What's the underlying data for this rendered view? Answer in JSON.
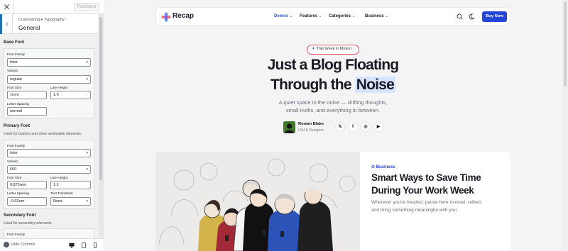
{
  "customizer": {
    "publish_label": "Published",
    "breadcrumb": "Customizing ▸ Typography",
    "section_title": "General",
    "base_font": {
      "heading": "Base Font",
      "family_label": "Font Family",
      "family_value": "Inter",
      "variant_label": "Variant",
      "variant_value": "regular",
      "size_label": "Font Size",
      "size_value": "1rem",
      "line_height_label": "Line Height",
      "line_height_value": "1.6",
      "spacing_label": "Letter Spacing",
      "spacing_value": "normal"
    },
    "primary_font": {
      "heading": "Primary Font",
      "description": "Used for buttons and other actionable elements.",
      "family_label": "Font Family",
      "family_value": "Inter",
      "variant_label": "Variant",
      "variant_value": "600",
      "size_label": "Font Size",
      "size_value": "0.875rem",
      "line_height_label": "Line Height",
      "line_height_value": "1.2",
      "spacing_label": "Letter Spacing",
      "spacing_value": "-0.02em",
      "transform_label": "Text Transform",
      "transform_value": "None"
    },
    "secondary_font": {
      "heading": "Secondary Font",
      "description": "Used for secondary elements.",
      "family_label": "Font Family"
    },
    "footer": {
      "hide_label": "Hide Controls"
    }
  },
  "site": {
    "logo": "Recap",
    "nav": [
      {
        "label": "Demos"
      },
      {
        "label": "Features"
      },
      {
        "label": "Categories"
      },
      {
        "label": "Business"
      }
    ],
    "buy_label": "Buy Now",
    "brand_color": "#2545d8",
    "hero": {
      "pill": "This Week in Motion",
      "title_line1": "Just a Blog Floating",
      "title_line2_prefix": "Through the",
      "title_highlight": "Noise",
      "subtitle_line1": "A quiet space in the noise — drifting thoughts,",
      "subtitle_line2": "small truths, and everything in between."
    },
    "author": {
      "name": "Rowan Blake",
      "role": "UX/UI Designer",
      "socials": [
        "x-icon",
        "facebook-icon",
        "instagram-icon",
        "youtube-icon"
      ]
    },
    "featured": {
      "category": "Business",
      "title_line1": "Smart Ways to Save Time",
      "title_line2": "During Your Work Week",
      "excerpt_line1": "Wherever you're headed, pause here to reset, reflect,",
      "excerpt_line2": "and bring something meaningful with you."
    }
  }
}
